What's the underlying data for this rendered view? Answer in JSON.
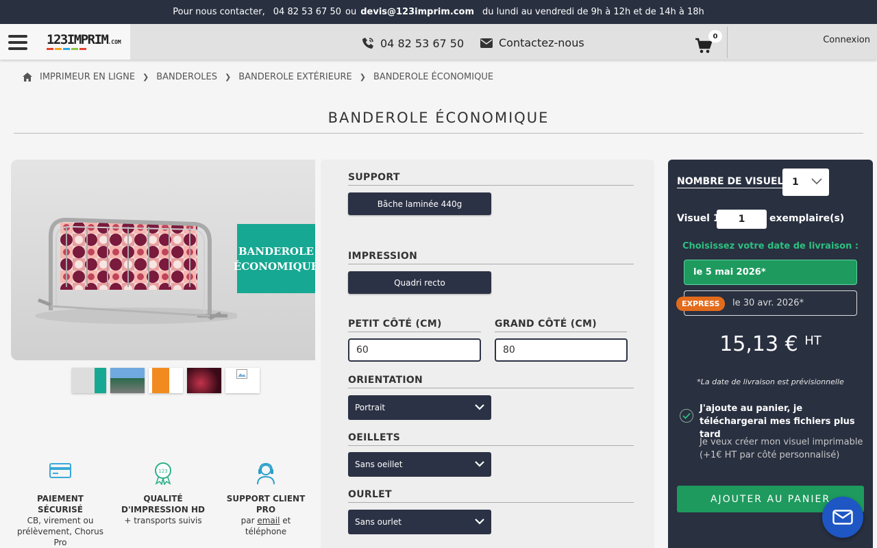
{
  "topbar": {
    "prefix": "Pour nous contacter,",
    "phone": "04 82 53 67 50",
    "or": "ou",
    "email": "devis@123imprim.com",
    "hours": "du lundi au vendredi de 9h à 12h et de 14h à 18h"
  },
  "header": {
    "logo_text": "123IMPRIM",
    "logo_suffix": ".COM",
    "phone": "04 82 53 67 50",
    "contact_label": "Contactez-nous",
    "cart_count": "0",
    "login_label": "Connexion",
    "icons": [
      "menu-icon",
      "phone-icon",
      "envelope-icon",
      "cart-icon"
    ]
  },
  "breadcrumb": {
    "items": [
      "IMPRIMEUR EN LIGNE",
      "BANDEROLES",
      "BANDEROLE EXTÉRIEURE",
      "BANDEROLE ÉCONOMIQUE"
    ]
  },
  "page": {
    "title": "BANDEROLE ÉCONOMIQUE"
  },
  "product": {
    "promo_line1": "BANDEROLE",
    "promo_line2": "ÉCONOMIQUE",
    "thumbnail_count": 5
  },
  "features": [
    {
      "icon": "credit-card-icon",
      "title": "PAIEMENT SÉCURISÉ",
      "sub": "CB, virement ou prélèvement, Chorus Pro"
    },
    {
      "icon": "award-badge-icon",
      "title": "QUALITÉ D'IMPRESSION HD",
      "sub": "+ transports suivis"
    },
    {
      "icon": "headset-support-icon",
      "title": "SUPPORT CLIENT PRO",
      "sub_prefix": "par",
      "sub_link": "email",
      "sub_suffix": "et téléphone"
    }
  ],
  "options": {
    "support": {
      "label": "SUPPORT",
      "value": "Bâche laminée 440g"
    },
    "impression": {
      "label": "IMPRESSION",
      "value": "Quadri recto"
    },
    "petit_cote": {
      "label": "PETIT CÔTÉ (CM)",
      "value": "60"
    },
    "grand_cote": {
      "label": "GRAND CÔTÉ (CM)",
      "value": "80"
    },
    "orientation": {
      "label": "ORIENTATION",
      "value": "Portrait"
    },
    "oeillets": {
      "label": "OEILLETS",
      "value": "Sans oeillet"
    },
    "ourlet": {
      "label": "OURLET",
      "value": "Sans ourlet"
    }
  },
  "sidebar": {
    "nb_visuels_label": "NOMBRE DE VISUELS",
    "nb_visuels_value": "1",
    "visuel_label": "Visuel 1",
    "qty_value": "1",
    "exemplaires_label": "exemplaire(s)",
    "choose_date_label": "Choisissez votre date de livraison :",
    "date_standard": "le 5 mai 2026*",
    "express_badge": "EXPRESS",
    "date_express": "le 30 avr. 2026*",
    "price": "15,13 €",
    "price_suffix": "HT",
    "note": "*La date de livraison est prévisionnelle",
    "option_checked": "J'ajoute au panier, je téléchargerai mes fichiers plus tard",
    "option_alt": "Je veux créer mon visuel imprimable (+1€ HT par côté personnalisé)",
    "add_cart_label": "AJOUTER AU PANIER"
  },
  "colors": {
    "dark_navy": "#293040",
    "button_navy": "#2c3245",
    "green": "#1e9a5e",
    "green_text": "#2cc07f",
    "express_orange": "#e36b1c",
    "promo_teal": "#17a893",
    "chat_blue": "#1e56c4"
  }
}
